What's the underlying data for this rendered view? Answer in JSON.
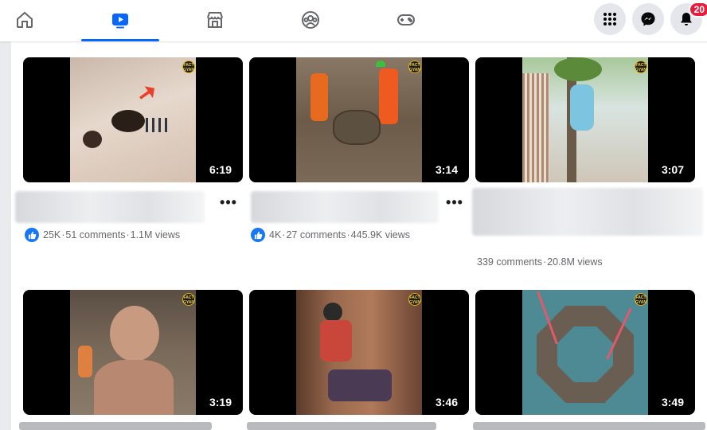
{
  "nav": {
    "items": [
      {
        "name": "Home",
        "icon": "home-icon"
      },
      {
        "name": "Video",
        "icon": "video-icon",
        "active": true
      },
      {
        "name": "Marketplace",
        "icon": "marketplace-icon"
      },
      {
        "name": "Groups",
        "icon": "groups-icon"
      },
      {
        "name": "Gaming",
        "icon": "gaming-icon"
      }
    ],
    "accent_color": "#0866ff",
    "notification_count": "20"
  },
  "videos": [
    {
      "duration": "6:19",
      "likes": "25K",
      "comments": "51 comments",
      "views": "1.1M views",
      "scene": "sand cave excavation"
    },
    {
      "duration": "3:14",
      "likes": "4K",
      "comments": "27 comments",
      "views": "445.9K views",
      "scene": "workers digging fossil"
    },
    {
      "duration": "3:07",
      "comments": "339 comments",
      "views": "20.8M views",
      "scene": "couple climbing tree"
    },
    {
      "duration": "3:19",
      "scene": "shaved head child"
    },
    {
      "duration": "3:46",
      "scene": "climber in canyon"
    },
    {
      "duration": "3:49",
      "scene": "offshore octagon platform"
    }
  ],
  "separator": "·"
}
